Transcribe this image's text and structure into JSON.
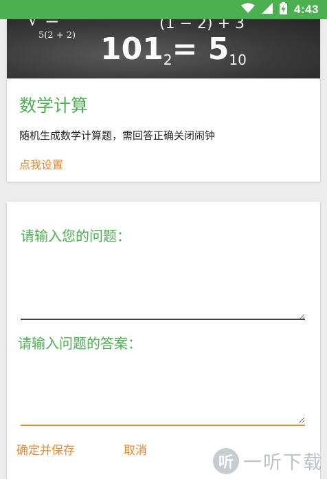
{
  "status_bar": {
    "time": "4:43",
    "icons": [
      "wifi-icon",
      "signal-icon",
      "battery-charging-icon"
    ],
    "background": "#4caf50"
  },
  "feature_card": {
    "banner_formulas": [
      "5(2 + 2)",
      "(1 − 2) + 3",
      "101",
      "2",
      "= 5",
      "10"
    ],
    "title": "数学计算",
    "description": "随机生成数学计算题，需回答正确关闭闹钟",
    "settings_link": "点我设置"
  },
  "form": {
    "question_label": "请输入您的问题：",
    "question_value": "",
    "answer_label": "请输入问题的答案：",
    "answer_value": "",
    "save_button": "确定并保存",
    "cancel_button": "取消"
  },
  "watermark": {
    "logo_char": "听",
    "text": "一听下载"
  },
  "colors": {
    "accent_green": "#4caf50",
    "accent_orange": "#e8892f"
  }
}
